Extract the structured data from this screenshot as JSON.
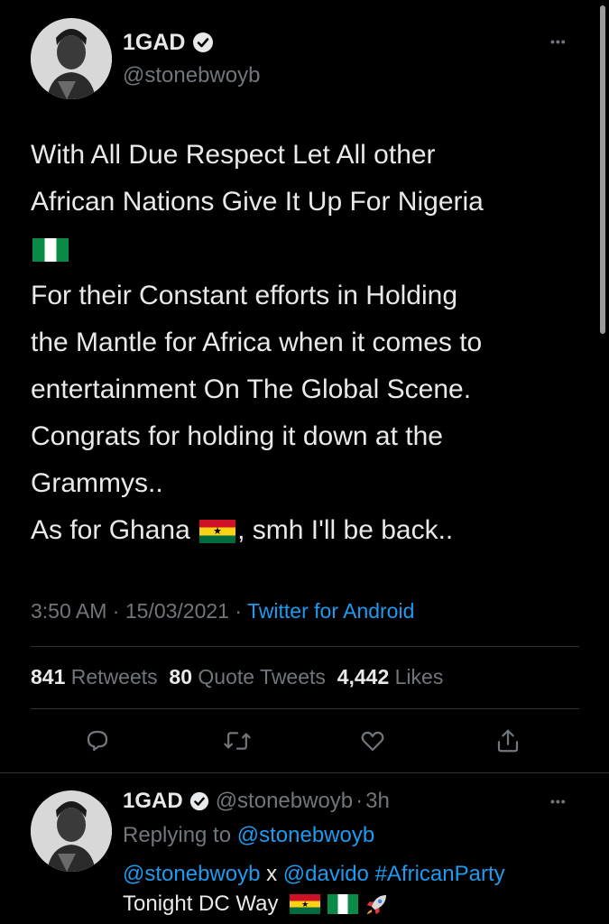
{
  "tweet": {
    "author_name": "1GAD",
    "author_handle": "@stonebwoyb",
    "more_label": "•••",
    "lines": [
      "With All Due Respect Let All other",
      "African Nations  Give It Up For Nigeria"
    ],
    "lines_after_flag": [
      "For their Constant efforts in Holding",
      "the Mantle for Africa when it comes to",
      "entertainment On The Global Scene.",
      "Congrats for holding it down at the",
      "Grammys.."
    ],
    "last_line_prefix": "As for Ghana ",
    "last_line_suffix": ", smh I'll be back..",
    "time": "3:50 AM",
    "date": "15/03/2021",
    "separator": "·",
    "source": "Twitter for Android"
  },
  "stats": {
    "retweets_count": "841",
    "retweets_label": "Retweets",
    "quotes_count": "80",
    "quotes_label": "Quote Tweets",
    "likes_count": "4,442",
    "likes_label": "Likes"
  },
  "actions": {
    "reply_icon": "reply-icon",
    "retweet_icon": "retweet-icon",
    "like_icon": "heart-icon",
    "share_icon": "share-icon"
  },
  "reply": {
    "author_name": "1GAD",
    "author_handle": "@stonebwoyb",
    "time_ago": "3h",
    "separator": "·",
    "more_label": "•••",
    "replying_to_label": "Replying to",
    "replying_to_handle": "@stonebwoyb",
    "mention_1": "@stonebwoyb",
    "x_word": " x ",
    "mention_2": "@davido",
    "hashtag": "#AfricanParty",
    "text_line2": "Tonight DC Way "
  },
  "colors": {
    "background": "#000000",
    "text": "#e7e9ea",
    "secondary": "#71767b",
    "accent": "#1d9bf0",
    "verified": "#1d9bf0"
  }
}
